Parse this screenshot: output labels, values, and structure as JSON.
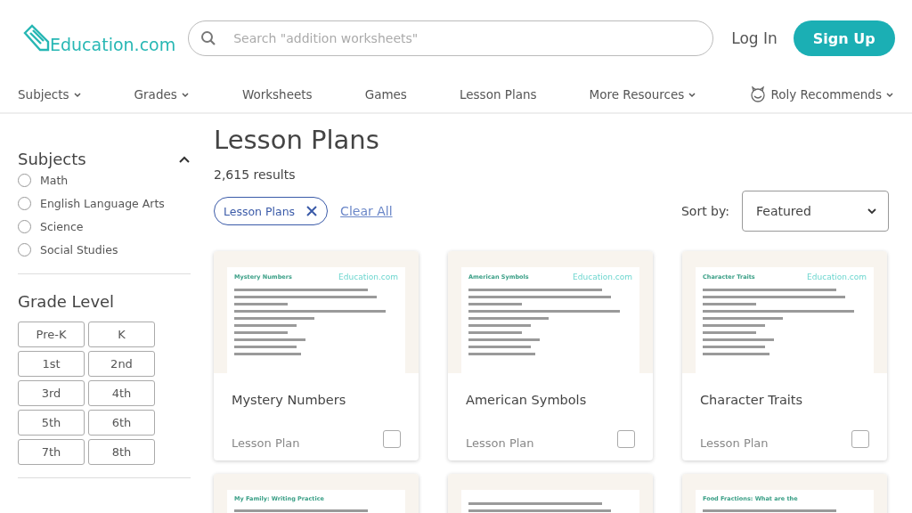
{
  "header": {
    "logo": "Education.com",
    "search": {
      "placeholder": "Search \"addition worksheets\""
    },
    "login": "Log In",
    "signup": "Sign Up"
  },
  "nav": [
    {
      "label": "Subjects",
      "dropdown": true,
      "mascot": false
    },
    {
      "label": "Grades",
      "dropdown": true,
      "mascot": false
    },
    {
      "label": "Worksheets",
      "dropdown": false,
      "mascot": false
    },
    {
      "label": "Games",
      "dropdown": false,
      "mascot": false
    },
    {
      "label": "Lesson Plans",
      "dropdown": false,
      "mascot": false
    },
    {
      "label": "More Resources",
      "dropdown": true,
      "mascot": false
    },
    {
      "label": "Roly Recommends",
      "dropdown": true,
      "mascot": true
    }
  ],
  "sidebar": {
    "subjects": {
      "title": "Subjects",
      "expanded": true,
      "options": [
        {
          "label": "Math",
          "selected": false
        },
        {
          "label": "English Language Arts",
          "selected": false
        },
        {
          "label": "Science",
          "selected": false
        },
        {
          "label": "Social Studies",
          "selected": false
        }
      ]
    },
    "grade_level": {
      "title": "Grade Level",
      "grades": [
        {
          "label": "Pre-K",
          "selected": false
        },
        {
          "label": "K",
          "selected": false
        },
        {
          "label": "1st",
          "selected": false
        },
        {
          "label": "2nd",
          "selected": false
        },
        {
          "label": "3rd",
          "selected": false
        },
        {
          "label": "4th",
          "selected": false
        },
        {
          "label": "5th",
          "selected": false
        },
        {
          "label": "6th",
          "selected": false
        },
        {
          "label": "7th",
          "selected": false
        },
        {
          "label": "8th",
          "selected": false
        }
      ]
    }
  },
  "main": {
    "title": "Lesson Plans",
    "results": "2,615 results",
    "filters": [
      {
        "label": "Lesson Plans"
      }
    ],
    "clear_all": "Clear All",
    "sort_label": "Sort by:",
    "sort_value": "Featured",
    "cards": [
      {
        "preview_title": "Mystery Numbers",
        "preview_brand": "Education.com",
        "title": "Mystery Numbers",
        "type": "Lesson Plan",
        "checked": false
      },
      {
        "preview_title": "American Symbols",
        "preview_brand": "Education.com",
        "title": "American Symbols",
        "type": "Lesson Plan",
        "checked": false
      },
      {
        "preview_title": "Character Traits",
        "preview_brand": "Education.com",
        "title": "Character Traits",
        "type": "Lesson Plan",
        "checked": false
      },
      {
        "preview_title": "My Family: Writing Practice"
      },
      {
        "kind": "blank-preview"
      },
      {
        "preview_title": "Food Fractions: What are the"
      }
    ]
  }
}
